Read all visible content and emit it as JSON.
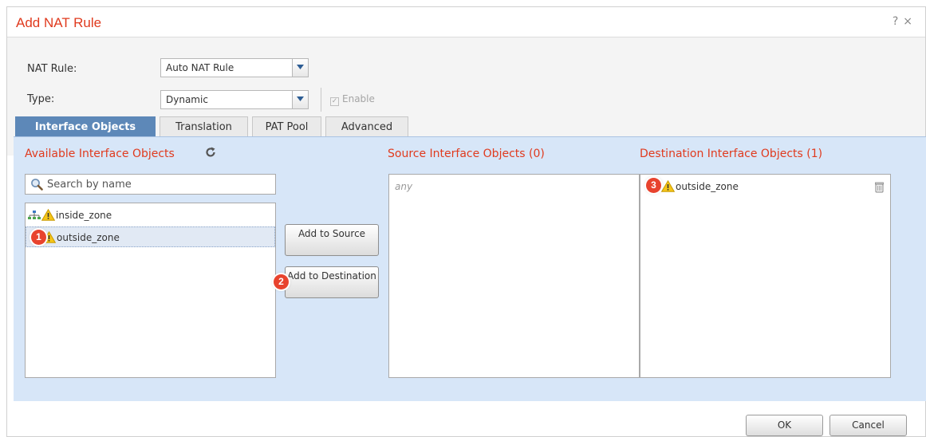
{
  "dialog": {
    "title": "Add NAT Rule",
    "help_icon": "?",
    "close_icon": "×"
  },
  "form": {
    "nat_rule_label": "NAT Rule:",
    "nat_rule_value": "Auto NAT Rule",
    "type_label": "Type:",
    "type_value": "Dynamic",
    "enable_label": "Enable",
    "enable_checked": true
  },
  "tabs": [
    {
      "label": "Interface Objects",
      "active": true
    },
    {
      "label": "Translation",
      "active": false
    },
    {
      "label": "PAT Pool",
      "active": false
    },
    {
      "label": "Advanced",
      "active": false
    }
  ],
  "available": {
    "title": "Available Interface Objects",
    "search_placeholder": "Search by name",
    "items": [
      {
        "label": "inside_zone",
        "icons": [
          "network-icon",
          "warning-icon"
        ],
        "selected": false
      },
      {
        "label": "outside_zone",
        "icons": [
          "warning-icon"
        ],
        "selected": true
      }
    ]
  },
  "buttons": {
    "add_to_source": "Add to Source",
    "add_to_destination": "Add to Destination",
    "ok": "OK",
    "cancel": "Cancel"
  },
  "source": {
    "title": "Source Interface Objects (0)",
    "empty_text": "any"
  },
  "destination": {
    "title": "Destination Interface Objects (1)",
    "items": [
      {
        "label": "outside_zone",
        "icons": [
          "warning-icon",
          "trash-icon"
        ]
      }
    ]
  },
  "callouts": [
    "1",
    "2",
    "3"
  ],
  "colors": {
    "title": "#e03a1e",
    "active_tab": "#5d88b8",
    "panel_bg": "#d7e6f8",
    "callout": "#e8432e"
  }
}
